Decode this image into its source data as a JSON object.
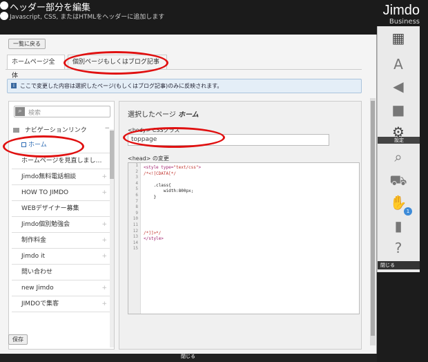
{
  "header": {
    "title": "ヘッダー部分を編集",
    "subtitle": "Javascript, CSS, またはHTMLをヘッダーに追加します"
  },
  "brand": {
    "name": "Jimdo",
    "tier": "Business"
  },
  "toolbar": {
    "back_label": "一覧に戻る",
    "save_label": "保存"
  },
  "tabs": [
    {
      "label": "ホームページ全体"
    },
    {
      "label": "個別ページもしくはブログ記事"
    }
  ],
  "info": {
    "text": "ここで変更した内容は選択したページ(もしくはブログ記事)のみに反映されます。"
  },
  "nav": {
    "search_placeholder": "検索",
    "section_label": "ナビゲーションリンク",
    "items": [
      {
        "label": "ホーム",
        "selected": true
      },
      {
        "label": "ホームページを見直しまし…"
      },
      {
        "label": "Jimdo無料電話相談"
      },
      {
        "label": "HOW TO JIMDO"
      },
      {
        "label": "WEBデザイナー募集"
      },
      {
        "label": "Jimdo個別勉強会"
      },
      {
        "label": "制作料金"
      },
      {
        "label": "Jimdo it"
      },
      {
        "label": "問い合わせ"
      },
      {
        "label": "new Jimdo"
      },
      {
        "label": "JIMDOで集客"
      }
    ]
  },
  "editor": {
    "title_prefix": "選択したページ",
    "title_page": "ホーム",
    "body_label": "<body> CSSクラス",
    "body_value": "toppage",
    "head_label": "<head> の変更",
    "line_numbers": [
      "1",
      "2",
      "3",
      "4",
      "5",
      "6",
      "7",
      "8",
      "9",
      "10",
      "11",
      "12",
      "13",
      "14",
      "15"
    ],
    "code": {
      "l1_tag": "<style type=",
      "l1_str": "\"text/css\"",
      "l1_end": ">",
      "l2": "/*<![CDATA[*/",
      "l4": "    .class{",
      "l5": "        width:800px;",
      "l6": "    }",
      "l12": "/*]]>*/",
      "l13": "</style>"
    }
  },
  "rail": {
    "settings_label": "設定",
    "cart_badge": "1",
    "close_label": "閉じる"
  },
  "bottom_close_label": "閉じる",
  "colors": {
    "accent": "#2d6cb5",
    "annotation": "#e01010"
  }
}
